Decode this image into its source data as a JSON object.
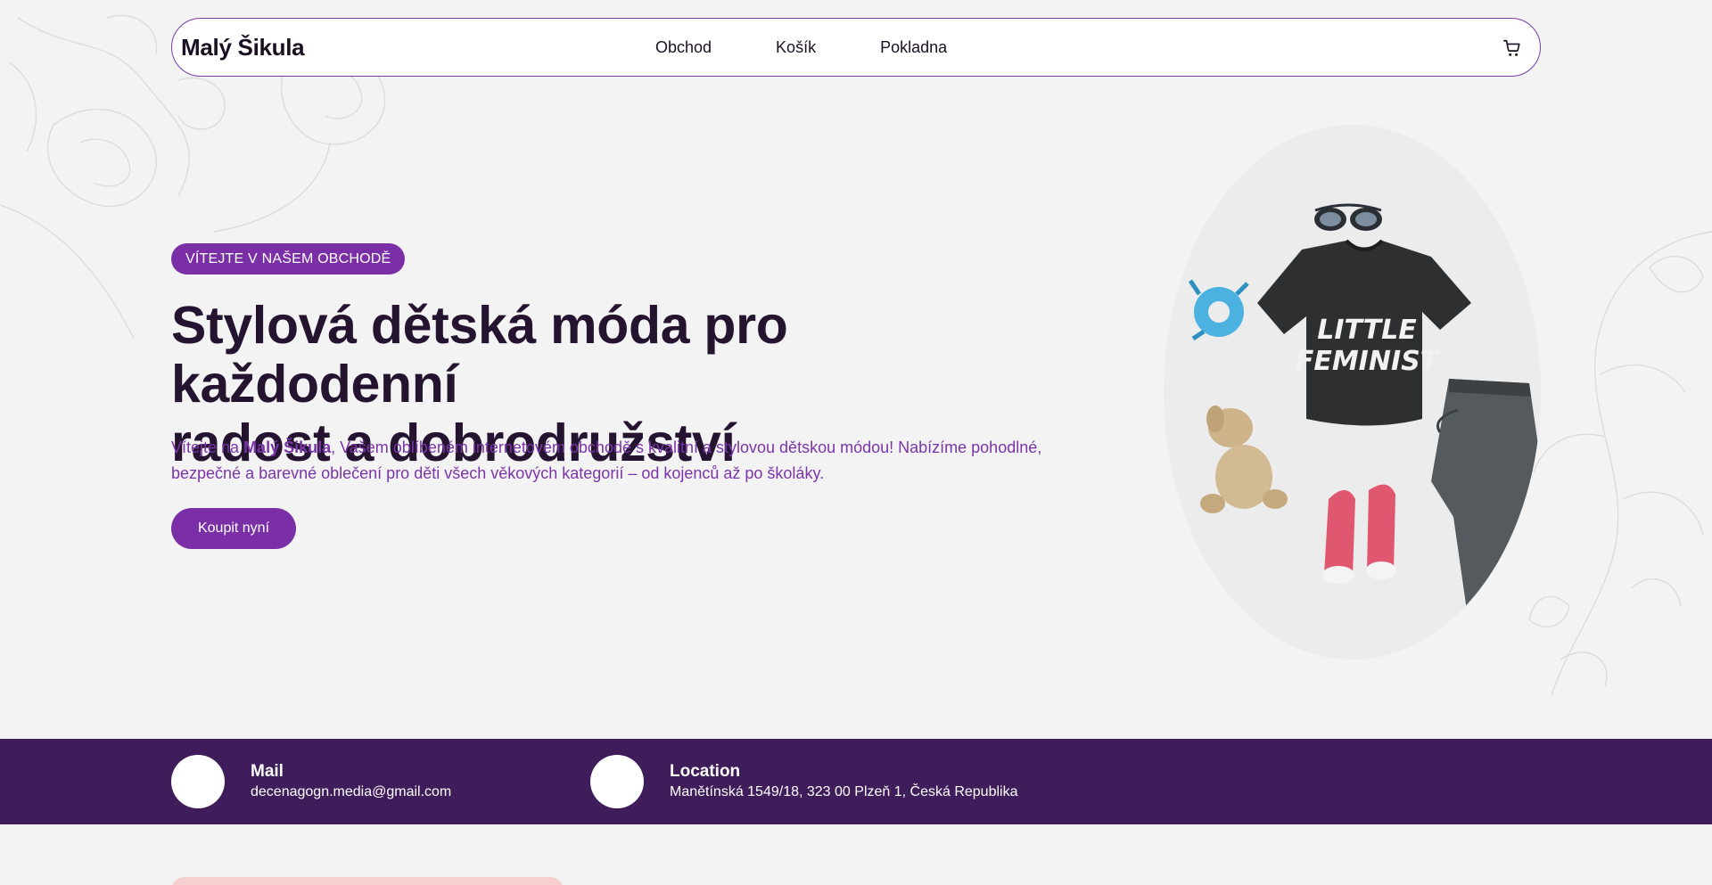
{
  "header": {
    "logo": "Malý Šikula",
    "nav": [
      "Obchod",
      "Košík",
      "Pokladna"
    ],
    "cart_icon": "cart-icon"
  },
  "hero": {
    "badge": "VÍTEJTE V NAŠEM OBCHODĚ",
    "title_line1": "Stylová dětská móda pro každodenní",
    "title_line2": "radost a dobrodružství",
    "text_prefix": "Vítejte na ",
    "text_brand": "Malý Šikula",
    "text_rest": ", Vašem oblíbeném internetovém obchodě s kvalitní a stylovou dětskou módou! Nabízíme pohodlné, bezpečné a barevné oblečení pro děti všech věkových kategorií – od kojenců až po školáky.",
    "cta": "Koupit nyní",
    "image_print_line1": "LITTLE",
    "image_print_line2": "FEMINIST"
  },
  "contact": {
    "mail_title": "Mail",
    "mail_value": "decenagogn.media@gmail.com",
    "location_title": "Location",
    "location_value": "Manětínská 1549/18, 323 00 Plzeň 1, Česká Republika"
  },
  "colors": {
    "accent": "#7b2fa6",
    "band": "#3f1d5b",
    "background": "#f3f3f4",
    "heading": "#24142f"
  }
}
